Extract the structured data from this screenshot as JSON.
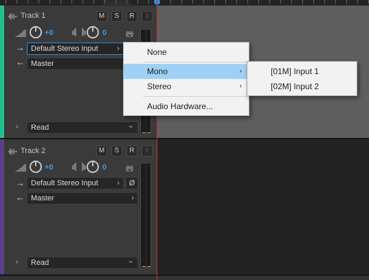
{
  "tracks": [
    {
      "name": "Track 1",
      "color": "#22c08f",
      "volume_value": "+0",
      "pan_value": "0",
      "mute_label": "M",
      "solo_label": "S",
      "record_label": "R",
      "input_label": "I",
      "monitor_label": "((•))",
      "input_route": "Default Stereo Input",
      "output_route": "Master",
      "automation_mode": "Read",
      "lane_color": "#5e5e5e"
    },
    {
      "name": "Track 2",
      "color": "#5b3f86",
      "volume_value": "+0",
      "pan_value": "0",
      "mute_label": "M",
      "solo_label": "S",
      "record_label": "R",
      "input_label": "I",
      "monitor_label": "((•))",
      "input_route": "Default Stereo Input",
      "output_route": "Master",
      "automation_mode": "Read",
      "phase_label": "Ø",
      "lane_color": "#232323"
    }
  ],
  "input_menu": {
    "items": [
      {
        "label": "None",
        "submenu": false,
        "highlighted": false
      },
      {
        "label": "Mono",
        "submenu": true,
        "highlighted": true
      },
      {
        "label": "Stereo",
        "submenu": true,
        "highlighted": false
      },
      {
        "label": "Audio Hardware...",
        "submenu": false,
        "highlighted": false
      }
    ],
    "submenu_arrow": "›"
  },
  "mono_submenu": {
    "items": [
      {
        "label": "[01M] Input 1"
      },
      {
        "label": "[02M] Input 2"
      }
    ]
  },
  "glyphs": {
    "chevron_right": "›",
    "chevron_down": "⌄",
    "expand": "›",
    "input_arrow": "→",
    "output_arrow": "←"
  },
  "colors": {
    "accent": "#2b8fe0",
    "playhead": "#c0392b",
    "menu_highlight": "#9ed1f5",
    "peak": "#e2c12e"
  }
}
